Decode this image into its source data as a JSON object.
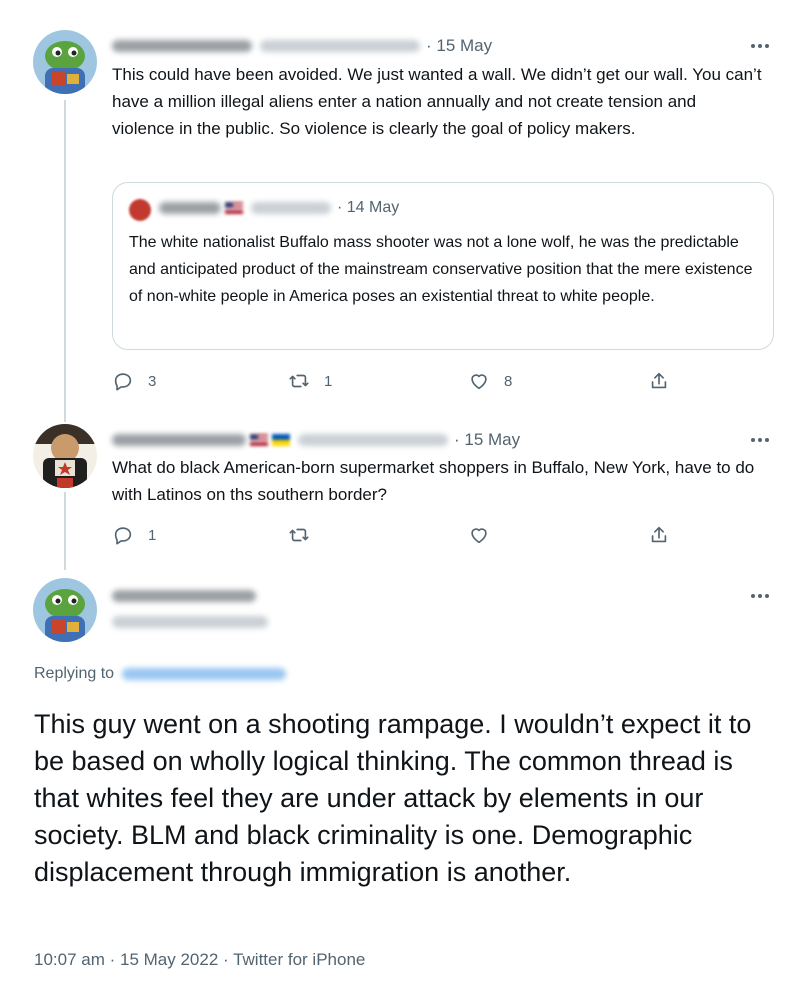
{
  "tweet1": {
    "date": "· 15 May",
    "text": "This could have been avoided. We just wanted a wall. We didn’t get our wall. You can’t have a million illegal aliens enter a nation annually and not create tension and violence in the public. So violence is clearly the goal of policy makers.",
    "quote": {
      "date": "· 14 May",
      "text": "The white nationalist Buffalo mass shooter was not a lone wolf, he was the predictable and anticipated product of the mainstream conservative position that the mere existence of non-white people in America poses an existential threat to white people."
    },
    "actions": {
      "reply_count": "3",
      "retweet_count": "1",
      "like_count": "8"
    }
  },
  "tweet2": {
    "date": "· 15 May",
    "text": "What do black American-born supermarket shoppers in Buffalo, New York, have to do with Latinos on ths southern border?",
    "actions": {
      "reply_count": "1"
    }
  },
  "main_tweet": {
    "replying_to_label": "Replying to",
    "text": "This guy went on a shooting rampage. I wouldn’t expect it to be based on wholly logical thinking. The common thread is that whites feel they are under attack by elements in our society. BLM and black criminality is one. Demographic displacement through immigration is another.",
    "meta": "10:07 am · 15 May 2022 · Twitter for iPhone"
  },
  "icons": [
    "more-icon",
    "reply-icon",
    "retweet-icon",
    "like-icon",
    "share-icon"
  ],
  "colors": {
    "text": "#0f1419",
    "secondary": "#536471",
    "border": "#cfd9de",
    "link": "#1d9bf0"
  }
}
